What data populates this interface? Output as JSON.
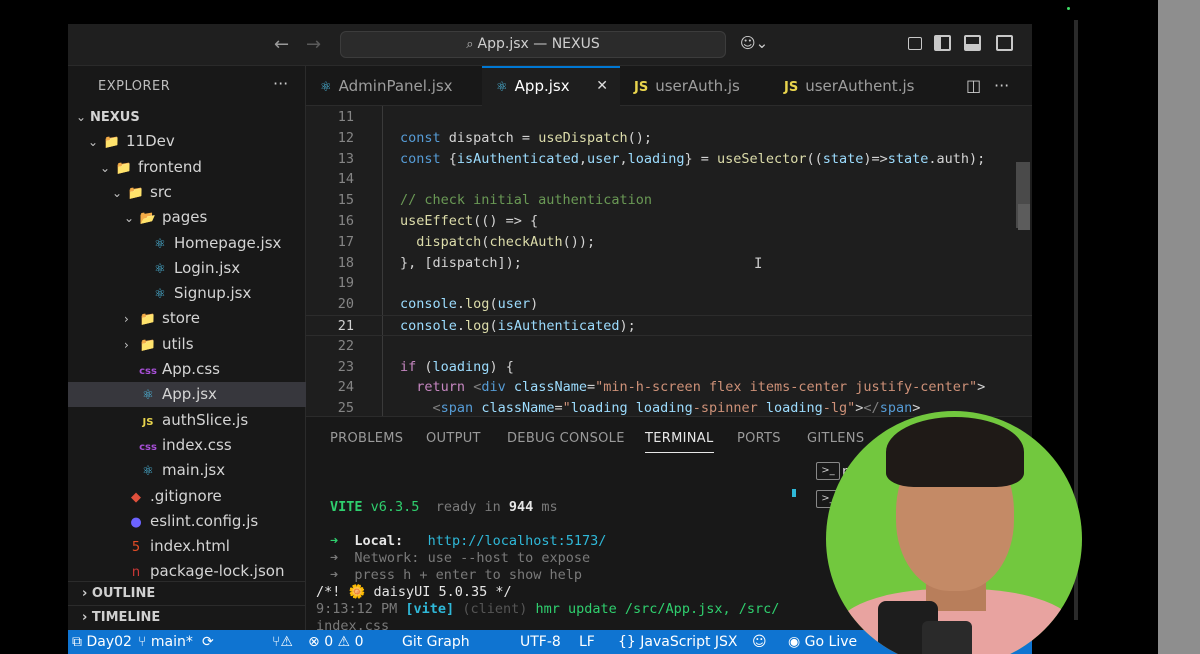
{
  "titlebar": {
    "back_icon": "arrow-left",
    "forward_icon": "arrow-right",
    "command_center": "App.jsx — NEXUS",
    "copilot_icon": "copilot"
  },
  "sidebar": {
    "title": "EXPLORER",
    "more": "···",
    "tree": [
      {
        "label": "NEXUS",
        "depth": 0,
        "chevron": "⌄",
        "icon": "",
        "bold": true
      },
      {
        "label": "11Dev",
        "depth": 1,
        "chevron": "⌄",
        "icon": "📁"
      },
      {
        "label": "frontend",
        "depth": 2,
        "chevron": "⌄",
        "icon": "📁"
      },
      {
        "label": "src",
        "depth": 3,
        "chevron": "⌄",
        "icon": "📁"
      },
      {
        "label": "pages",
        "depth": 4,
        "chevron": "⌄",
        "icon": "📂"
      },
      {
        "label": "Homepage.jsx",
        "depth": 5,
        "chevron": "",
        "icon": "⚛"
      },
      {
        "label": "Login.jsx",
        "depth": 5,
        "chevron": "",
        "icon": "⚛"
      },
      {
        "label": "Signup.jsx",
        "depth": 5,
        "chevron": "",
        "icon": "⚛"
      },
      {
        "label": "store",
        "depth": 4,
        "chevron": "›",
        "icon": "📁"
      },
      {
        "label": "utils",
        "depth": 4,
        "chevron": "›",
        "icon": "📁"
      },
      {
        "label": "App.css",
        "depth": 4,
        "chevron": "",
        "icon": "css"
      },
      {
        "label": "App.jsx",
        "depth": 4,
        "chevron": "",
        "icon": "⚛",
        "active": true
      },
      {
        "label": "authSlice.js",
        "depth": 4,
        "chevron": "",
        "icon": "JS"
      },
      {
        "label": "index.css",
        "depth": 4,
        "chevron": "",
        "icon": "css"
      },
      {
        "label": "main.jsx",
        "depth": 4,
        "chevron": "",
        "icon": "⚛"
      },
      {
        "label": ".gitignore",
        "depth": 3,
        "chevron": "",
        "icon": "◆"
      },
      {
        "label": "eslint.config.js",
        "depth": 3,
        "chevron": "",
        "icon": "●"
      },
      {
        "label": "index.html",
        "depth": 3,
        "chevron": "",
        "icon": "5"
      },
      {
        "label": "package-lock.json",
        "depth": 3,
        "chevron": "",
        "icon": "n"
      }
    ],
    "outline": "OUTLINE",
    "timeline": "TIMELINE"
  },
  "tabs": [
    {
      "label": "AdminPanel.jsx",
      "icon": "⚛"
    },
    {
      "label": "App.jsx",
      "icon": "⚛",
      "active": true,
      "close": "✕"
    },
    {
      "label": "userAuth.js",
      "icon": "JS"
    },
    {
      "label": "userAuthent.js",
      "icon": "JS"
    }
  ],
  "editor": {
    "lines": [
      {
        "n": "11",
        "code": ""
      },
      {
        "n": "12",
        "code": "const dispatch = useDispatch();"
      },
      {
        "n": "13",
        "code": "const {isAuthenticated,user,loading} = useSelector((state)=>state.auth);"
      },
      {
        "n": "14",
        "code": ""
      },
      {
        "n": "15",
        "code": "// check initial authentication"
      },
      {
        "n": "16",
        "code": "useEffect(() => {"
      },
      {
        "n": "17",
        "code": "  dispatch(checkAuth());"
      },
      {
        "n": "18",
        "code": "}, [dispatch]);"
      },
      {
        "n": "19",
        "code": ""
      },
      {
        "n": "20",
        "code": "console.log(user)"
      },
      {
        "n": "21",
        "code": "console.log(isAuthenticated);"
      },
      {
        "n": "22",
        "code": ""
      },
      {
        "n": "23",
        "code": "if (loading) {"
      },
      {
        "n": "24",
        "code": "  return <div className=\"min-h-screen flex items-center justify-center\">"
      },
      {
        "n": "25",
        "code": "    <span className=\"loading loading-spinner loading-lg\"></span>"
      }
    ]
  },
  "panel": {
    "tabs": [
      "PROBLEMS",
      "OUTPUT",
      "DEBUG CONSOLE",
      "TERMINAL",
      "PORTS",
      "GITLENS"
    ],
    "active_tab": "TERMINAL",
    "terminal": {
      "vite_name": "VITE",
      "vite_version": "v6.3.5",
      "ready": "ready in",
      "ready_ms": "944",
      "ready_unit": "ms",
      "local_label": "Local:",
      "local_url": "http://localhost:5173/",
      "network_label": "Network:",
      "network_text": "use --host to expose",
      "help_text": "press h + enter to show help",
      "daisy_line": "/*! 🌼 daisyUI 5.0.35 */",
      "hmr_time": "9:13:12 PM",
      "hmr_tag": "[vite]",
      "hmr_client": "(client)",
      "hmr_msg": "hmr update /src/App.jsx, /src/",
      "hmr_tail": "index.css",
      "side_label": "n"
    }
  },
  "statusbar": {
    "remote": "Day02",
    "branch": "main*",
    "errors": "0",
    "warnings": "0",
    "git_graph": "Git Graph",
    "encoding": "UTF-8",
    "eol": "LF",
    "language": "JavaScript JSX",
    "golive": "Go Live"
  },
  "colors": {
    "statusbar": "#0f74d1",
    "active_tab_border": "#0078d4",
    "webcam_bg": "#72c83e"
  }
}
